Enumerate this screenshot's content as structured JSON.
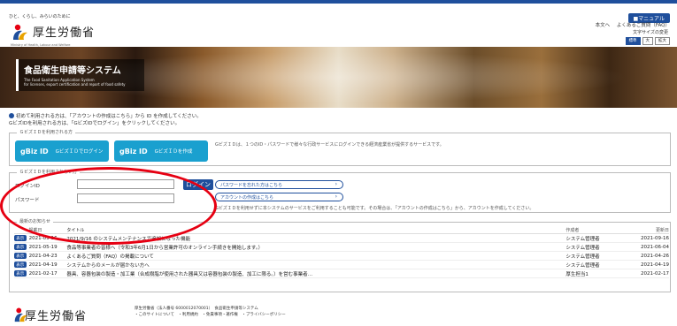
{
  "header": {
    "tagline": "ひと、くらし、みらいのために",
    "logo_text": "厚生労働省",
    "logo_sub": "Ministry of Health, Labour and Welfare",
    "manual_label": "■マニュアル",
    "links": [
      "本文へ",
      "よくあるご質問（FAQ）"
    ],
    "fontsize_label": "文字サイズの変更",
    "fontsize_buttons": [
      "標準",
      "大",
      "拡大"
    ]
  },
  "banner": {
    "title": "食品衛生申請等システム",
    "subtitle_line1": "The Food Sanitation Application System",
    "subtitle_line2": "for licenses, export certification and report of food safety"
  },
  "notice": {
    "line1": "初めて利用される方は、「アカウントの作成はこちら」から ID を作成してください。",
    "line2": "GビズIDを利用される方は、「GビズIDでログイン」をクリックしてください。"
  },
  "gbiz_section": {
    "legend": "ＧビズＩＤを利用される方",
    "login_button": "GビズＩＤでログイン",
    "create_button": "GビズＩＤを作成",
    "logo": "gBiz ID",
    "description": "GビズＩＤは、１つのID・パスワードで様々な行政サービスにログインできる経済産業省が提供するサービスです。"
  },
  "login_section": {
    "legend": "ＧビズＩＤを利用されない方",
    "id_label": "ログインID",
    "password_label": "パスワード",
    "login_button": "ログイン",
    "forgot_password": "パスワードを忘れた方はこちら",
    "create_account": "アカウントの作成はこちら",
    "note": "GビズＩＤを利用せずに本システムのサービスをご利用することも可能です。その場合は、「アカウントの作成はこちら」から、アカウントを作成してください。"
  },
  "news": {
    "legend": "最新のお知らせ",
    "headers": [
      "掲載日",
      "タイトル",
      "作成者",
      "更新日"
    ],
    "badge": "表示",
    "rows": [
      {
        "date": "2021-09-16",
        "title": "2021/9/16 のシステムメンテナンスで追加になった機能",
        "author": "システム管理者",
        "updated": "2021-09-16"
      },
      {
        "date": "2021-05-19",
        "title": "食品等事業者の皆様へ（令和3年6月1日から営業許可のオンライン手続きを開始します。）",
        "author": "システム管理者",
        "updated": "2021-06-04"
      },
      {
        "date": "2021-04-23",
        "title": "よくあるご質問（FAQ）の掲載について",
        "author": "システム管理者",
        "updated": "2021-04-26"
      },
      {
        "date": "2021-04-19",
        "title": "システムからのメールが届かない方へ",
        "author": "システム管理者",
        "updated": "2021-04-19"
      },
      {
        "date": "2021-02-17",
        "title": "器具、容器包装の製造・加工業（合成樹脂が使用された器具又は容器包装の製造、加工に限る。）を営む事業者…",
        "author": "厚生担当1",
        "updated": "2021-02-17"
      }
    ]
  },
  "footer": {
    "logo_text": "厚生労働省",
    "line1": "厚生労働省（法人番号 6000012070001）　食品衛生申請等システム",
    "line2": "・このサイトについて　・利用規約　・免責事項・著作権　・プライバシーポリシー"
  },
  "colors": {
    "primary": "#1f4f9c",
    "gbiz": "#1aa0cf",
    "annotation": "#e60012"
  }
}
